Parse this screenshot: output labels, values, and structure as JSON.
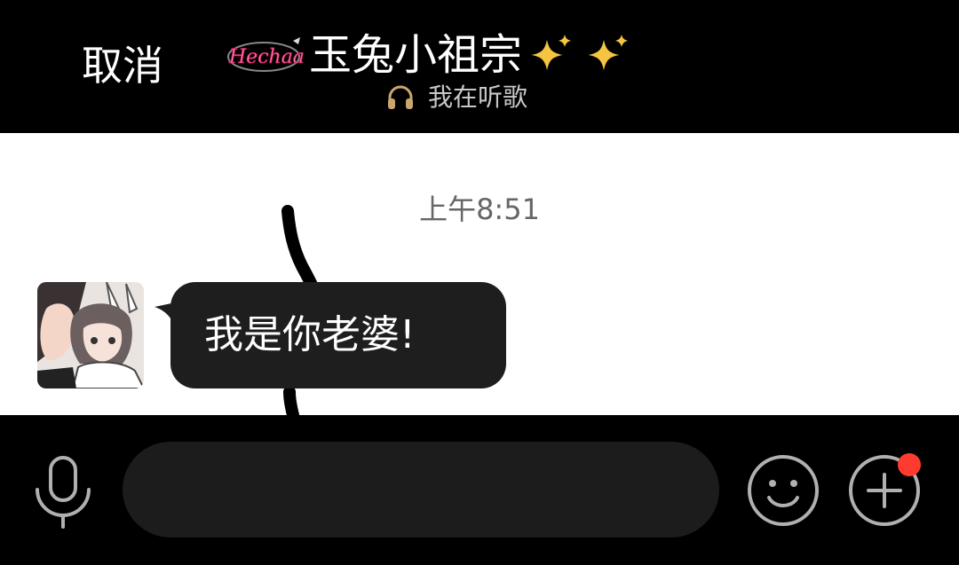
{
  "header": {
    "cancel_label": "取消",
    "contact_name": "玉兔小祖宗",
    "status_text": "我在听歌",
    "logo_text": "Hechaa"
  },
  "chat": {
    "timestamp": "上午8:51",
    "messages": [
      {
        "sender": "contact",
        "text": "我是你老婆!"
      }
    ]
  },
  "input_bar": {
    "text_value": "",
    "has_notification": true
  },
  "colors": {
    "background": "#000000",
    "chat_background": "#ffffff",
    "bubble": "#1e1e1e",
    "notification": "#ff3b30",
    "sparkle": "#f5c542",
    "icon_stroke": "#b0b0b0"
  },
  "icons": {
    "status": "headphones-icon",
    "mic": "microphone-icon",
    "emoji": "smiley-icon",
    "plus": "plus-circle-icon",
    "title_decoration": "sparkles-icon"
  }
}
